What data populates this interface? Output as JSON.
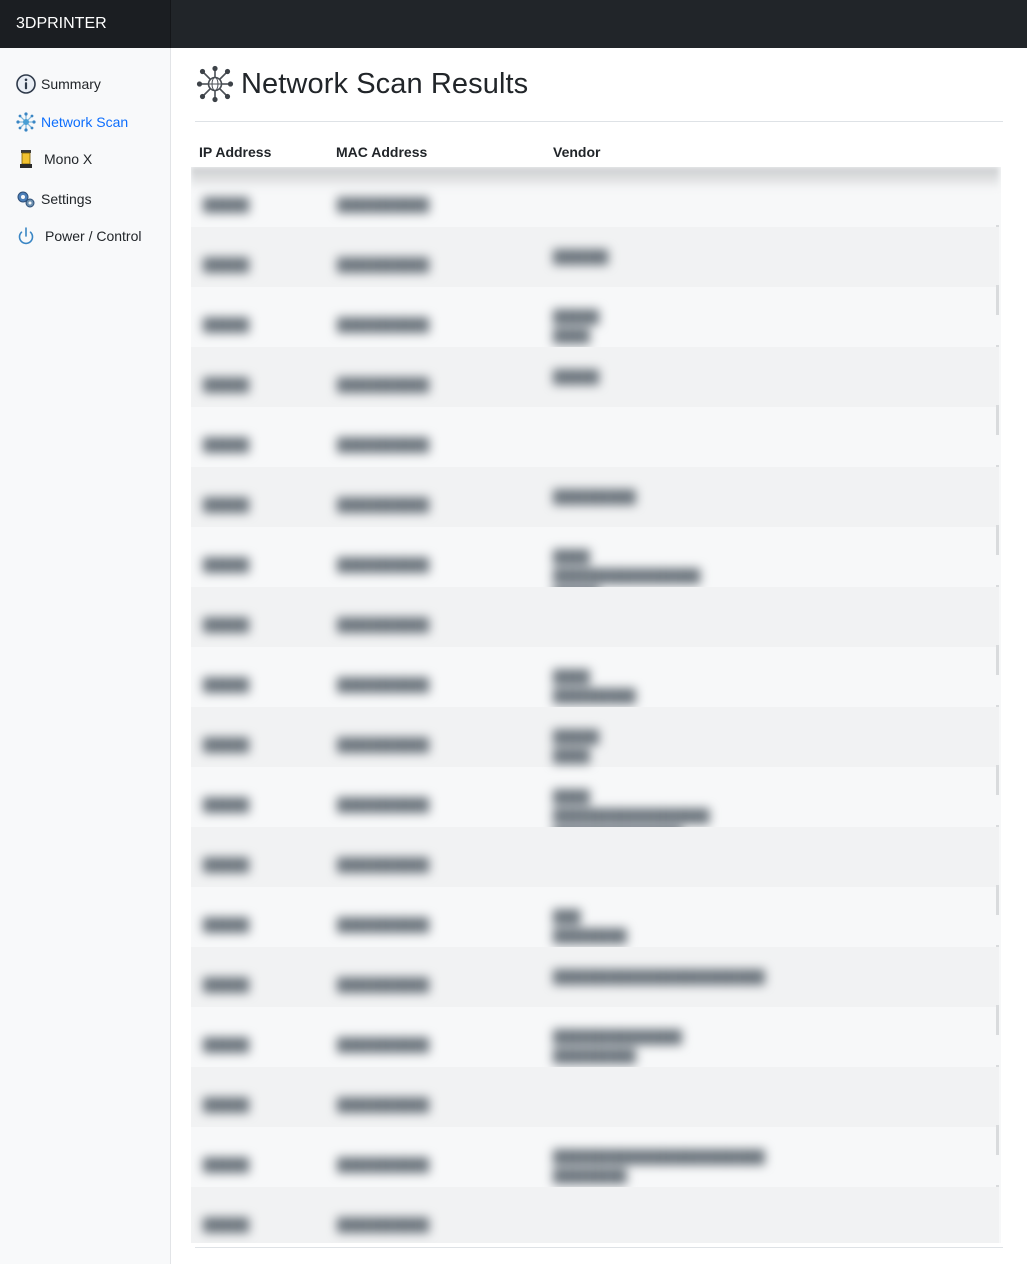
{
  "brand": "3DPRINTER",
  "sidebar": {
    "items": [
      {
        "label": "Summary",
        "icon": "info-icon"
      },
      {
        "label": "Network Scan",
        "icon": "network-icon",
        "active": true
      },
      {
        "label": "Mono X",
        "icon": "printer-icon"
      },
      {
        "label": "Settings",
        "icon": "gear-icon"
      },
      {
        "label": "Power / Control",
        "icon": "power-icon"
      }
    ]
  },
  "page": {
    "title": "Network Scan Results",
    "title_icon": "network-icon"
  },
  "table": {
    "columns": [
      "IP Address",
      "MAC Address",
      "Vendor"
    ],
    "rows_blurred": true
  },
  "colors": {
    "topbar": "#212529",
    "sidebar": "#f8f9fa",
    "active_link": "#0d6efd",
    "text": "#212529"
  }
}
